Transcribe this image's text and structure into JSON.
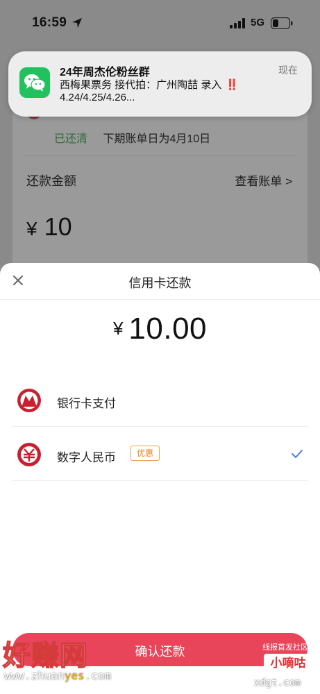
{
  "status_bar": {
    "time": "16:59",
    "network": "5G"
  },
  "notification": {
    "title": "24年周杰伦粉丝群",
    "time": "现在",
    "line1": "西梅果票务 接代拍：广州陶喆 录入",
    "line1_mark": "‼️",
    "line2": "4.24/4.25/4.26...",
    "icon": "wechat-icon"
  },
  "background": {
    "status_cleared": "已还清",
    "next_bill": "下期账单日为4月10日",
    "amount_label": "还款金额",
    "view_bill": "查看账单 >",
    "amount_symbol": "¥",
    "amount": "10"
  },
  "sheet": {
    "title": "信用卡还款",
    "amount_symbol": "¥",
    "amount": "10.00",
    "methods": [
      {
        "label": "银行卡支付",
        "icon": "bank-logo-icon",
        "selected": false
      },
      {
        "label": "数字人民币",
        "icon": "e-cny-icon",
        "badge": "优惠",
        "selected": true
      }
    ],
    "confirm_label": "确认还款"
  },
  "watermarks": {
    "left_big": "好赚网",
    "left_url_prefix": "www.zhuan",
    "left_url_highlight": "yes",
    "left_url_suffix": ".com",
    "right_top": "线报首发社区",
    "right_logo": "小嘀咕",
    "right_url": "xdgt.com"
  },
  "colors": {
    "accent_red": "#e8455a",
    "check_blue": "#4a7fd6",
    "badge_orange": "#e8872a",
    "wechat_green": "#21c25e"
  }
}
